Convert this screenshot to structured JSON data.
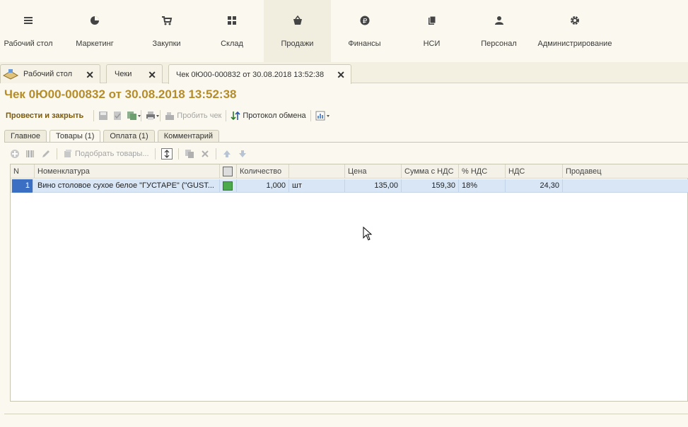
{
  "sections": [
    {
      "label": "Рабочий стол",
      "icon": "menu-icon",
      "active": false
    },
    {
      "label": "Маркетинг",
      "icon": "pie-chart-icon",
      "active": false
    },
    {
      "label": "Закупки",
      "icon": "cart-icon",
      "active": false
    },
    {
      "label": "Склад",
      "icon": "grid-icon",
      "active": false
    },
    {
      "label": "Продажи",
      "icon": "basket-icon",
      "active": true
    },
    {
      "label": "Финансы",
      "icon": "ruble-icon",
      "active": false
    },
    {
      "label": "НСИ",
      "icon": "books-icon",
      "active": false
    },
    {
      "label": "Персонал",
      "icon": "person-icon",
      "active": false
    },
    {
      "label": "Администрирование",
      "icon": "gear-icon",
      "active": false
    }
  ],
  "open_tabs": [
    {
      "label": "Рабочий стол",
      "close": "✕"
    },
    {
      "label": "Чеки",
      "close": "✕"
    },
    {
      "label": "Чек 0Ю00-000832 от 30.08.2018 13:52:38",
      "close": "✕"
    }
  ],
  "document": {
    "title": "Чек 0Ю00-000832 от 30.08.2018 13:52:38"
  },
  "toolbar": {
    "post_and_close": "Провести и закрыть",
    "print_receipt": "Пробить чек",
    "exchange_log": "Протокол обмена"
  },
  "form_tabs": [
    {
      "label": "Главное",
      "active": false
    },
    {
      "label": "Товары (1)",
      "active": true
    },
    {
      "label": "Оплата (1)",
      "active": false
    },
    {
      "label": "Комментарий",
      "active": false
    }
  ],
  "goods_toolbar": {
    "pick_goods": "Подобрать товары..."
  },
  "table": {
    "headers": [
      "N",
      "Номенклатура",
      "",
      "Количество",
      "",
      "Цена",
      "Сумма с НДС",
      "% НДС",
      "НДС",
      "Продавец"
    ],
    "rows": [
      {
        "n": "1",
        "item": "Вино столовое сухое белое \"ГУСТАРЕ\" (\"GUST...",
        "qty": "1,000",
        "unit": "шт",
        "price": "135,00",
        "sum_vat": "159,30",
        "vat_rate": "18%",
        "vat": "24,30",
        "seller": ""
      }
    ]
  },
  "colors": {
    "title": "#b58c2a",
    "selected_row": "#d8e6f6",
    "background": "#fbf9ef"
  }
}
